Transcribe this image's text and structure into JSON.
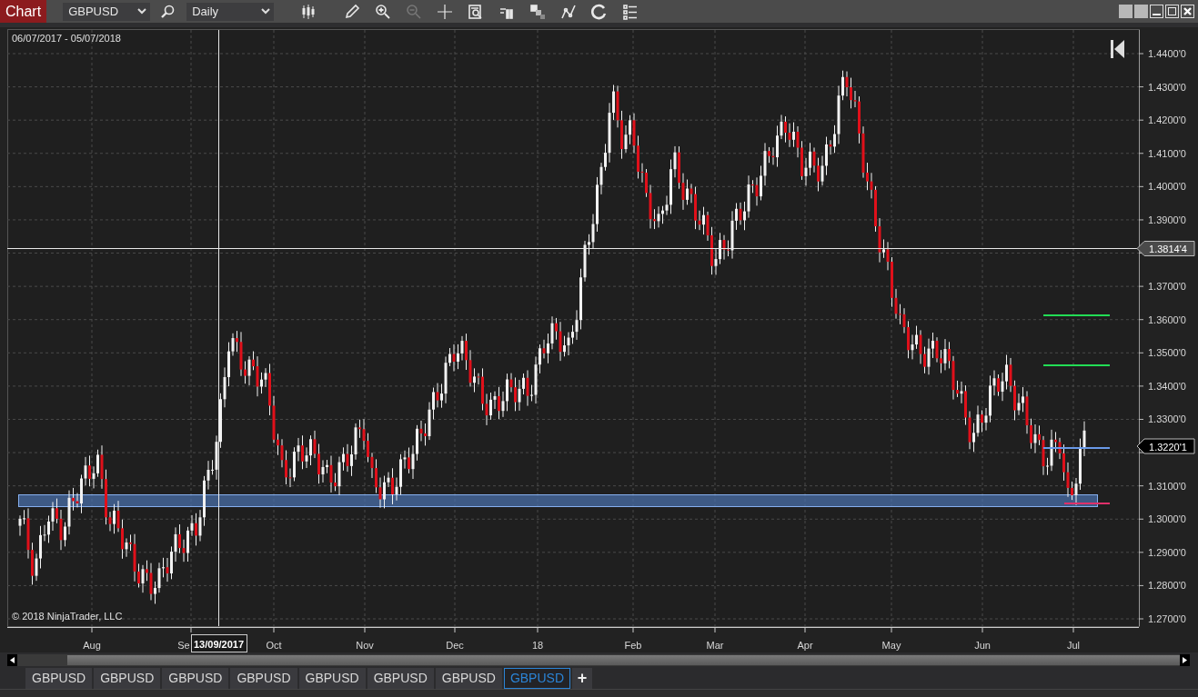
{
  "toolbar": {
    "title": "Chart",
    "instrument": "GBPUSD",
    "interval": "Daily"
  },
  "chart": {
    "date_range": "06/07/2017 - 05/07/2018",
    "copyright": "© 2018 NinjaTrader, LLC",
    "price_ticks": [
      "1.4400'0",
      "1.4300'0",
      "1.4200'0",
      "1.4100'0",
      "1.4000'0",
      "1.3900'0",
      "1.3700'0",
      "1.3600'0",
      "1.3500'0",
      "1.3400'0",
      "1.3300'0",
      "1.3100'0",
      "1.3000'0",
      "1.2900'0",
      "1.2800'0",
      "1.2700'0"
    ],
    "time_ticks": [
      "Aug",
      "Se",
      "Oct",
      "Nov",
      "Dec",
      "18",
      "Feb",
      "Mar",
      "Apr",
      "May",
      "Jun",
      "Jul"
    ],
    "crosshair_price": "1.3814'4",
    "last_price": "1.3220'1",
    "crosshair_date": "13/09/2017"
  },
  "tabs": [
    {
      "label": "GBPUSD",
      "selected": false
    },
    {
      "label": "GBPUSD",
      "selected": false
    },
    {
      "label": "GBPUSD",
      "selected": false
    },
    {
      "label": "GBPUSD",
      "selected": false
    },
    {
      "label": "GBPUSD",
      "selected": false
    },
    {
      "label": "GBPUSD",
      "selected": false
    },
    {
      "label": "GBPUSD",
      "selected": false
    },
    {
      "label": "GBPUSD",
      "selected": true
    }
  ],
  "add_tab": "+"
}
